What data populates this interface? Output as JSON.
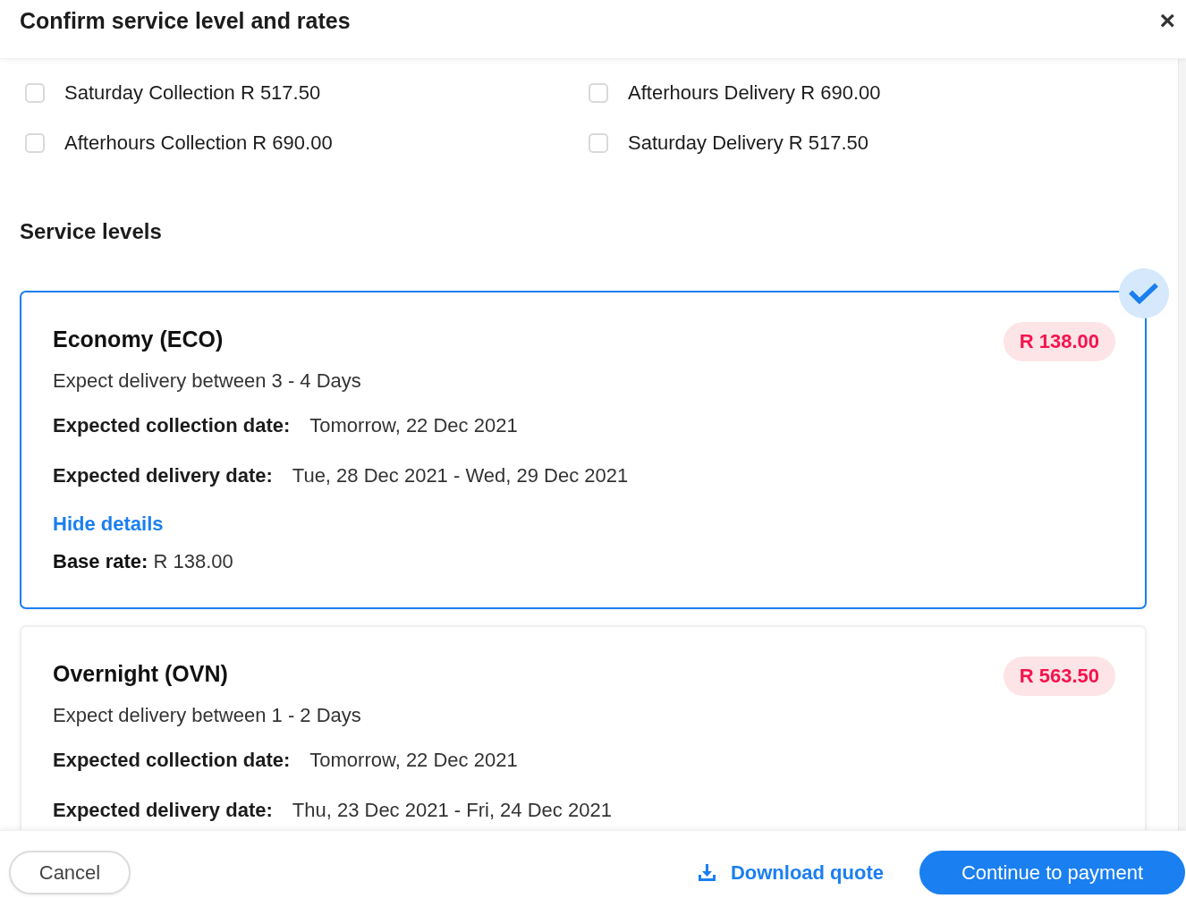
{
  "dialog": {
    "title": "Confirm service level and rates",
    "close": "×"
  },
  "addons": [
    {
      "label": "Saturday Collection R 517.50",
      "checked": false
    },
    {
      "label": "Afterhours Delivery R 690.00",
      "checked": false
    },
    {
      "label": "Afterhours Collection R 690.00",
      "checked": false
    },
    {
      "label": "Saturday Delivery R 517.50",
      "checked": false
    }
  ],
  "service_levels": {
    "heading": "Service levels",
    "options": [
      {
        "name": "Economy (ECO)",
        "price": "R 138.00",
        "description": "Expect delivery between 3 - 4 Days",
        "details": [
          {
            "label": "Expected collection date:",
            "value": "Tomorrow, 22 Dec 2021"
          },
          {
            "label": "Expected delivery date:",
            "value": "Tue, 28 Dec 2021 - Wed, 29 Dec 2021"
          }
        ],
        "toggle": "Hide details",
        "base_rate": "**Base rate:** R 138.00",
        "selected": true
      },
      {
        "name": "Overnight (OVN)",
        "price": "R 563.50",
        "description": "Expect delivery between 1 - 2 Days",
        "details": [
          {
            "label": "Expected collection date:",
            "value": "Tomorrow, 22 Dec 2021"
          },
          {
            "label": "Expected delivery date:",
            "value": "Thu, 23 Dec 2021 - Fri, 24 Dec 2021"
          }
        ],
        "selected": false
      }
    ]
  },
  "footer": {
    "cancel": "Cancel",
    "download": "Download quote",
    "continue": "Continue to payment"
  }
}
